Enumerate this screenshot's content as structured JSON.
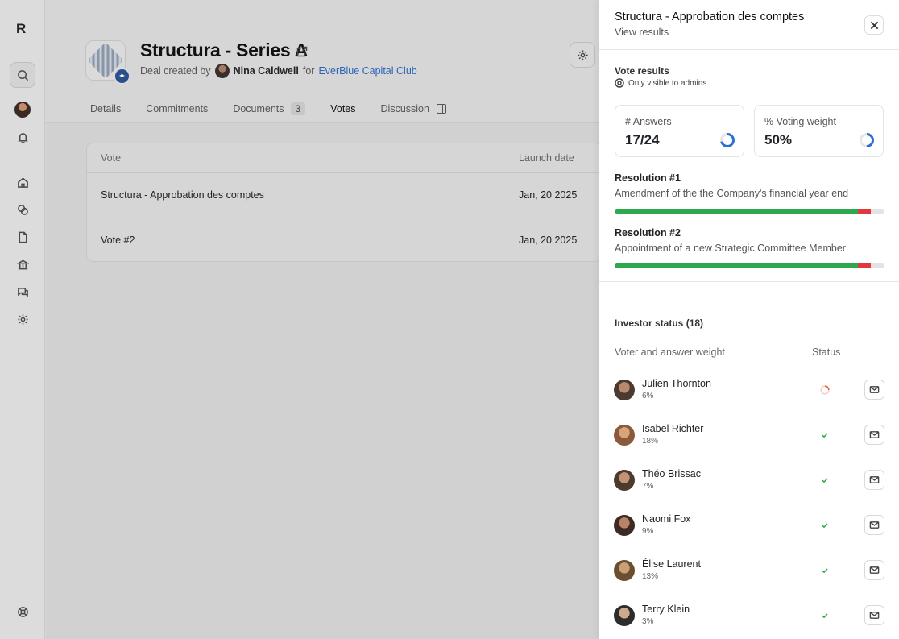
{
  "rail": {
    "logo": "R"
  },
  "deal": {
    "title": "Structura - Series A",
    "created_prefix": "Deal created by",
    "creator": "Nina Caldwell",
    "for_word": "for",
    "club": "EverBlue Capital Club"
  },
  "tabs": [
    {
      "label": "Details"
    },
    {
      "label": "Commitments"
    },
    {
      "label": "Documents",
      "count": "3"
    },
    {
      "label": "Votes",
      "active": true
    },
    {
      "label": "Discussion"
    }
  ],
  "votes_table": {
    "headers": {
      "vote": "Vote",
      "launch_date": "Launch date"
    },
    "rows": [
      {
        "vote": "Structura - Approbation des comptes",
        "launch_date": "Jan, 20 2025"
      },
      {
        "vote": "Vote #2",
        "launch_date": "Jan, 20 2025"
      }
    ]
  },
  "panel": {
    "title": "Structura - Approbation des comptes",
    "subtitle": "View results",
    "vote_results_title": "Vote results",
    "visibility_note": "Only visible to admins",
    "stats": {
      "answers_label": "# Answers",
      "answers_value": "17/24",
      "answers_fraction": 0.7083,
      "weight_label": "% Voting weight",
      "weight_value": "50%",
      "weight_fraction": 0.5
    },
    "resolutions": [
      {
        "title": "Resolution #1",
        "description": "Amendmenf of the the Company's financial year end",
        "yes_fraction": 0.9,
        "no_fraction": 0.05
      },
      {
        "title": "Resolution #2",
        "description": "Appointment of a new Strategic Committee Member",
        "yes_fraction": 0.9,
        "no_fraction": 0.05
      }
    ],
    "investor_status_title": "Investor status (18)",
    "investor_headers": {
      "voter": "Voter and answer weight",
      "status": "Status"
    },
    "investors": [
      {
        "name": "Julien Thornton",
        "weight": "6%",
        "status": "pending"
      },
      {
        "name": "Isabel Richter",
        "weight": "18%",
        "status": "voted"
      },
      {
        "name": "Théo Brissac",
        "weight": "7%",
        "status": "voted"
      },
      {
        "name": "Naomi Fox",
        "weight": "9%",
        "status": "voted"
      },
      {
        "name": "Élise Laurent",
        "weight": "13%",
        "status": "voted"
      },
      {
        "name": "Terry Klein",
        "weight": "3%",
        "status": "voted"
      }
    ]
  },
  "colors": {
    "accent": "#2b63b8",
    "yes": "#2ea84f",
    "no": "#e0383e",
    "pending": "#e8643a",
    "ring": "#2b6fd6"
  }
}
